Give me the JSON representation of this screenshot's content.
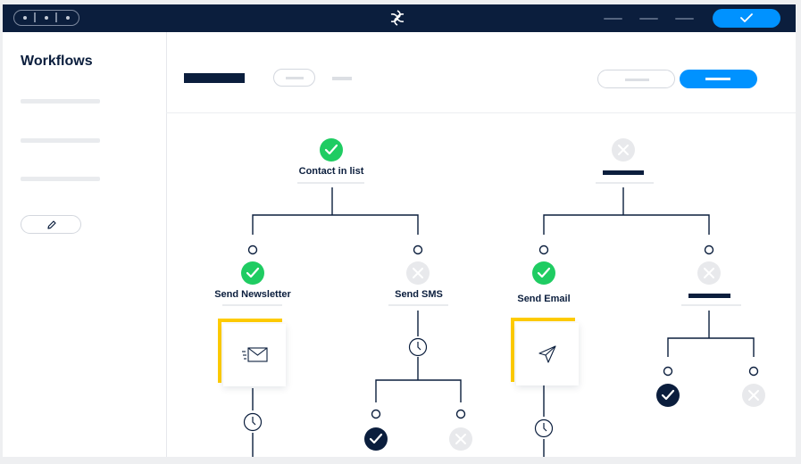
{
  "sidebar": {
    "title": "Workflows"
  },
  "workflow": {
    "trigger_label": "Contact in list",
    "branches": [
      {
        "label": "Send Newsletter",
        "status": "success"
      },
      {
        "label": "Send SMS",
        "status": "inactive"
      },
      {
        "label": "Send Email",
        "status": "success"
      }
    ]
  },
  "colors": {
    "navy": "#0b1e3d",
    "brand_blue": "#0092ff",
    "success_green": "#1fcc62",
    "inactive_gray": "#e8e9ec",
    "accent_yellow": "#ffcc00"
  },
  "icons": [
    "logo-icon",
    "check-icon",
    "pencil-icon",
    "envelope-icon",
    "paper-plane-icon",
    "clock-icon",
    "x-icon"
  ]
}
